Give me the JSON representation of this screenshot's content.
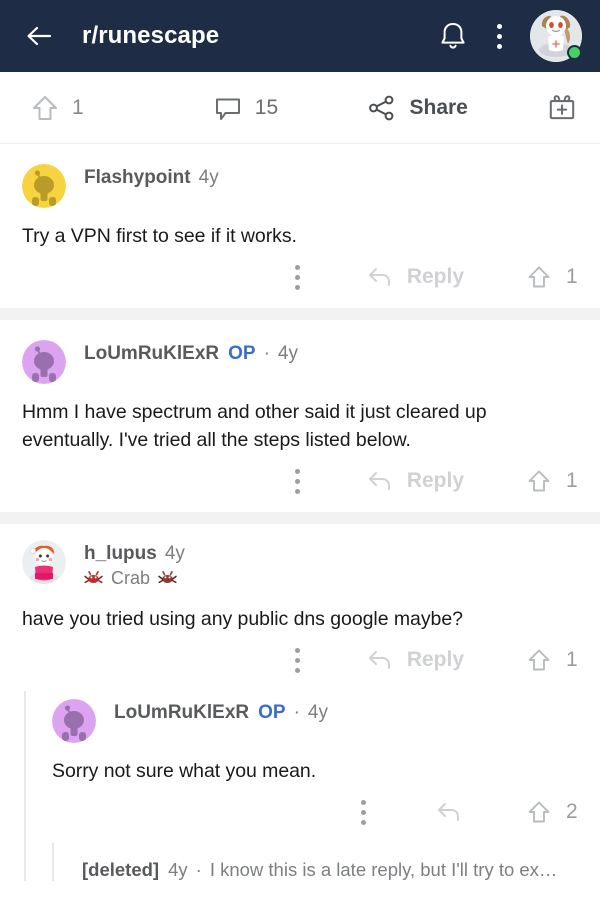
{
  "header": {
    "back_icon": "back-arrow-icon",
    "title": "r/runescape",
    "bell_icon": "notification-bell-icon",
    "overflow_icon": "kebab-menu-icon",
    "avatar_icon": "user-avatar",
    "status": "online",
    "bg_color": "#1e2d45"
  },
  "post_actions": {
    "upvote_icon": "upvote-arrow-icon",
    "upvote_count": "1",
    "comment_icon": "comment-bubble-icon",
    "comment_count": "15",
    "share_icon": "share-icon",
    "share_label": "Share",
    "award_icon": "gift-award-icon"
  },
  "actions_common": {
    "kebab_icon": "kebab-menu-icon",
    "reply_icon": "reply-arrow-icon",
    "reply_label": "Reply",
    "upvote_icon": "upvote-arrow-icon"
  },
  "comments": [
    {
      "id": "flashypoint",
      "username": "Flashypoint",
      "op": "",
      "age": "4y",
      "avatar_color": "#f7d33f",
      "snoo_color": "#b79c2a",
      "body": "Try a VPN first to see if it works.",
      "upvotes": "1",
      "has_reply_label": true
    },
    {
      "id": "loumruklexr-1",
      "username": "LoUmRuKlExR",
      "op": "OP",
      "sep": "·",
      "age": "4y",
      "avatar_color": "#dca4f0",
      "snoo_color": "#9a6fad",
      "body": "Hmm I have spectrum and other said it just cleared up eventually. I've tried all the steps listed below.",
      "upvotes": "1",
      "has_reply_label": true
    },
    {
      "id": "h-lupus",
      "username": "h_lupus",
      "op": "",
      "age": "4y",
      "flair_text": "Crab",
      "flair_emoji_left": "crab-emoji",
      "flair_emoji_right": "crab-emoji",
      "body": "have you tried using any public dns google maybe?",
      "upvotes": "1",
      "has_reply_label": true
    }
  ],
  "nested_reply": {
    "id": "loumruklexr-2",
    "username": "LoUmRuKlExR",
    "op": "OP",
    "sep": "·",
    "age": "4y",
    "avatar_color": "#dca4f0",
    "snoo_color": "#9a6fad",
    "body": "Sorry not sure what you mean.",
    "upvotes": "2"
  },
  "collapsed_comment": {
    "username": "[deleted]",
    "age": "4y",
    "sep": "·",
    "snippet": "I know this is a late reply, but I'll try to ex…"
  },
  "colors": {
    "op_blue": "#3a6ec9",
    "body_text": "#1a1a1b",
    "muted": "#7c7f81",
    "divider": "#f2f2f3"
  }
}
